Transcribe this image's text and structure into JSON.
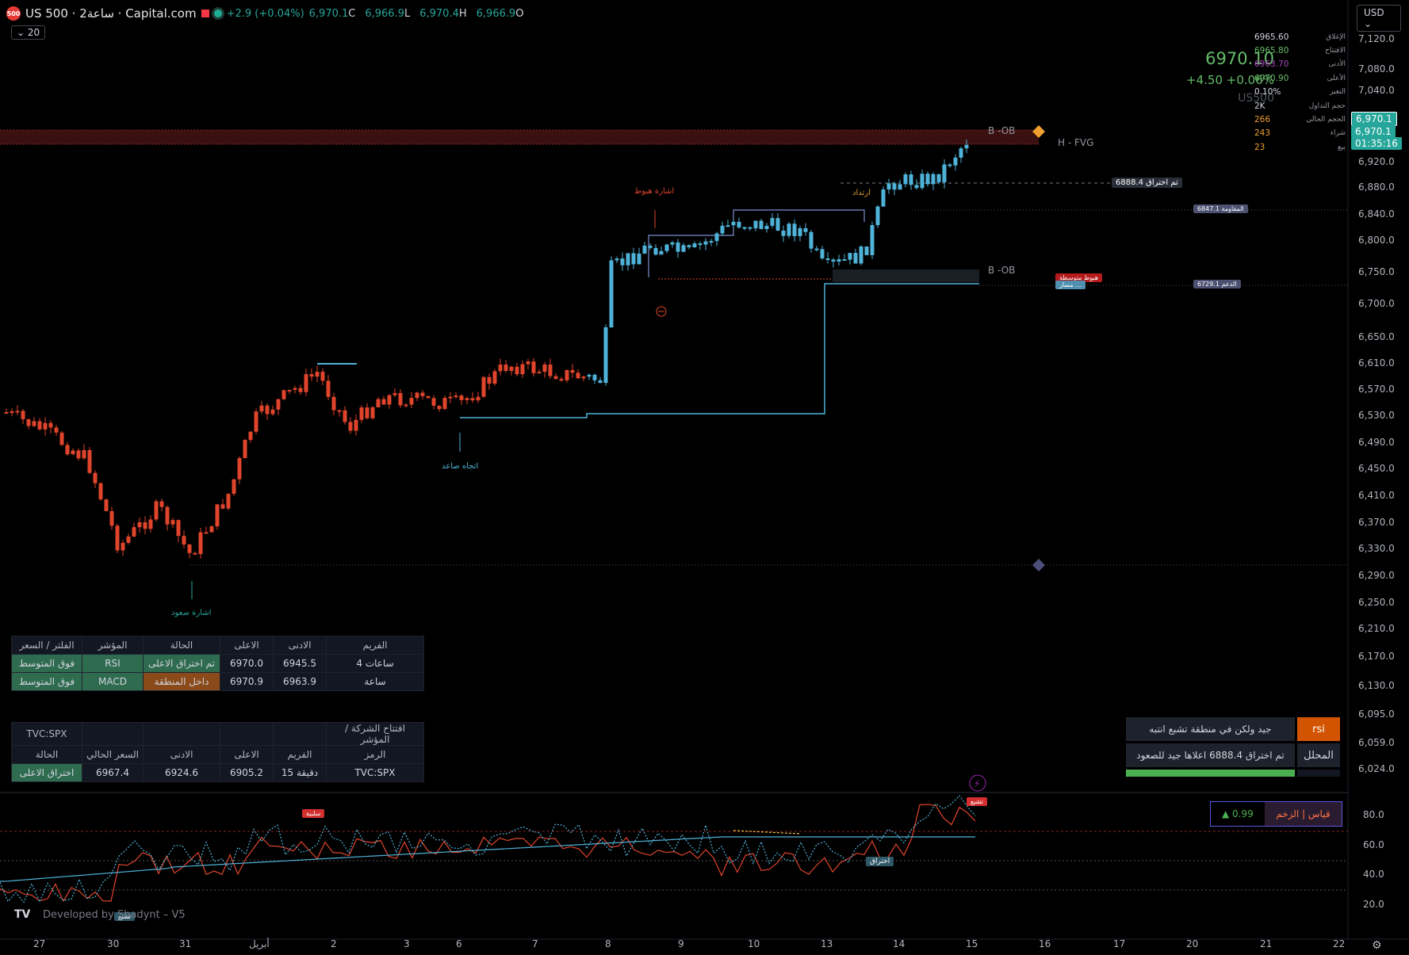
{
  "header": {
    "logo": "500",
    "symbol_title": "US 500 · 2ساعة · Capital.com",
    "change": "+2.9 (+0.04%)",
    "ohlc": {
      "open": "6,970.1",
      "open_key": "C",
      "low": "6,966.9",
      "low_key": "L",
      "high": "6,970.4",
      "high_key": "H",
      "close": "6,966.9",
      "close_key": "O"
    },
    "interval": "20",
    "currency": "USD"
  },
  "price_panel": {
    "price": "6970.10",
    "change": "+4.50 +0.06%",
    "symbol": "US500"
  },
  "stats": [
    {
      "value": "6965.60",
      "key": "الإغلاق",
      "color": "#d1d4dc"
    },
    {
      "value": "6965.80",
      "key": "الافتتاح",
      "color": "#66bb6a"
    },
    {
      "value": "6963.70",
      "key": "الأدنى",
      "color": "#ab47bc"
    },
    {
      "value": "6970.90",
      "key": "الأعلى",
      "color": "#66bb6a"
    },
    {
      "value": "0.10%",
      "key": "التغير",
      "color": "#d1d4dc"
    },
    {
      "value": "2K",
      "key": "حجم التداول",
      "color": "#d1d4dc"
    },
    {
      "value": "266",
      "key": "الحجم الحالي",
      "color": "#f0a030"
    },
    {
      "value": "243",
      "key": "شراء",
      "color": "#f0a030"
    },
    {
      "value": "23",
      "key": "بيع",
      "color": "#f0a030"
    }
  ],
  "price_axis": [
    "7,120.0",
    "7,080.0",
    "7,040.0",
    "6,920.0",
    "6,880.0",
    "6,840.0",
    "6,800.0",
    "6,750.0",
    "6,700.0",
    "6,650.0",
    "6,610.0",
    "6,570.0",
    "6,530.0",
    "6,490.0",
    "6,450.0",
    "6,410.0",
    "6,370.0",
    "6,330.0",
    "6,290.0",
    "6,250.0",
    "6,210.0",
    "6,170.0",
    "6,130.0",
    "6,095.0",
    "6,059.0",
    "6,024.0"
  ],
  "price_badges": {
    "last": "6,970.1",
    "current": "6,970.1",
    "countdown": "01:35:16"
  },
  "rsi_axis": [
    "80.0",
    "60.0",
    "40.0",
    "20.0"
  ],
  "time_axis": [
    "27",
    "30",
    "31",
    "أبريل",
    "2",
    "3",
    "6",
    "7",
    "8",
    "9",
    "10",
    "13",
    "14",
    "15",
    "16",
    "17",
    "20",
    "21",
    "22"
  ],
  "annotations": {
    "b_ob_top": "B -OB",
    "h_fvg": "H - FVG",
    "b_ob_mid": "B -OB",
    "breakout_label": "6888.4  تم اختراق",
    "resistance_tag": "6847.1  المقاومة",
    "support_tag": "6729.1  الدعم",
    "medium_down": "هبوط متوسطة",
    "rebound_path": "مسار ...",
    "sell_signal": "اشارة هبوط",
    "rebound": "ارتداد",
    "up_trend": "اتجاه صاعد",
    "buy_signal": "اشارة صعود",
    "negative": "سلبية",
    "saturation": "تشبع",
    "breakout": "اختراق",
    "saturation_low": "تشبع"
  },
  "table1": {
    "headers": [
      "الفلتر / السعر",
      "المؤشر",
      "الحالة",
      "الاعلى",
      "الادنى",
      "الفريم"
    ],
    "rows": [
      [
        "فوق المتوسط",
        "RSI",
        "تم اختراق الاعلى",
        "6970.0",
        "6945.5",
        "ساعات 4"
      ],
      [
        "فوق المتوسط",
        "MACD",
        "داخل المنطقة",
        "6970.9",
        "6963.9",
        "ساعة"
      ]
    ]
  },
  "table2": {
    "title_left": "TVC:SPX",
    "title_right": "افتتاح الشركة / المؤشر",
    "headers": [
      "الحالة",
      "السعر الحالي",
      "الادنى",
      "الاعلى",
      "الفريم",
      "الرمز"
    ],
    "row": [
      "اختراق الاعلى",
      "6967.4",
      "6924.6",
      "6905.2",
      "15 دقيقة",
      "TVC:SPX"
    ]
  },
  "analyst": {
    "row1_text": "جيد ولكن في منطقة تشبع انتبه",
    "row1_badge": "rsi",
    "row2_text": "تم اختراق 6888.4 اعلاها جيد للصعود",
    "row2_badge": "المحلل"
  },
  "gauge": {
    "value": "▲ 0.99",
    "label": "قياس | الزخم"
  },
  "watermark": {
    "logo": "TV",
    "text": "Developed by Shadynt – V5"
  },
  "colors": {
    "up": "#4fb3d9",
    "down": "#e0452c",
    "ob_zone": "#3a1010",
    "accent": "#26a69a"
  }
}
